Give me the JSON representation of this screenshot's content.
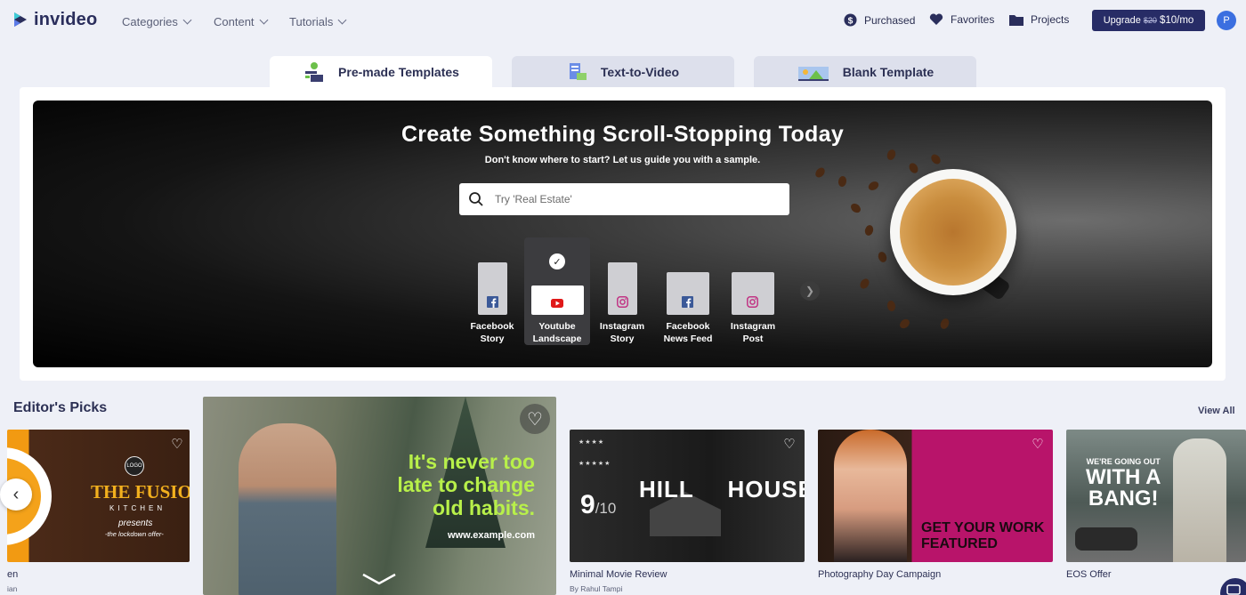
{
  "brand": {
    "name": "invideo"
  },
  "nav": {
    "categories": "Categories",
    "content": "Content",
    "tutorials": "Tutorials",
    "purchased": "Purchased",
    "favorites": "Favorites",
    "projects": "Projects",
    "upgrade_prefix": "Upgrade",
    "upgrade_old_price": "$20",
    "upgrade_price": "$10/mo",
    "avatar_initial": "P"
  },
  "tabs": [
    {
      "label": "Pre-made Templates",
      "active": true
    },
    {
      "label": "Text-to-Video",
      "active": false
    },
    {
      "label": "Blank Template",
      "active": false
    }
  ],
  "hero": {
    "title": "Create Something Scroll-Stopping Today",
    "subtitle": "Don't know where to start? Let us guide you with a sample.",
    "search_placeholder": "Try 'Real Estate'",
    "formats": [
      {
        "line1": "Facebook",
        "line2": "Story",
        "icon": "facebook-icon",
        "selected": false
      },
      {
        "line1": "Youtube",
        "line2": "Landscape",
        "icon": "youtube-icon",
        "selected": true
      },
      {
        "line1": "Instagram",
        "line2": "Story",
        "icon": "instagram-icon",
        "selected": false
      },
      {
        "line1": "Facebook",
        "line2": "News Feed",
        "icon": "facebook-icon",
        "selected": false
      },
      {
        "line1": "Instagram",
        "line2": "Post",
        "icon": "instagram-icon",
        "selected": false
      }
    ]
  },
  "picks": {
    "title": "Editor's Picks",
    "view_all": "View All",
    "items": [
      {
        "title_fragment": "en",
        "author_fragment": "ian",
        "thumb_text": "THE FUSION",
        "thumb_sub": "KITCHEN",
        "thumb_tag": "presents",
        "thumb_tag2": "-the lockdown offer-",
        "thumb_logo": "LOGO"
      },
      {
        "thumb_text1": "It's never too",
        "thumb_text2": "late to change",
        "thumb_text3": "old habits.",
        "thumb_url": "www.example.com"
      },
      {
        "title": "Minimal Movie Review",
        "author": "By Rahul Tampi",
        "thumb_title": "HILL HOUSE",
        "thumb_score": "9",
        "thumb_score_total": "/10"
      },
      {
        "title": "Photography Day Campaign",
        "thumb_text1": "GET YOUR WORK",
        "thumb_text2": "FEATURED"
      },
      {
        "title": "EOS Offer",
        "thumb_text1": "WE'RE GOING OUT",
        "thumb_text2": "WITH A",
        "thumb_text3": "BANG!"
      }
    ]
  },
  "colors": {
    "brand_navy": "#272c66",
    "background": "#eef0f7",
    "youtube_red": "#e01818",
    "facebook_blue": "#3b5998",
    "instagram_pink": "#c13584",
    "magenta_thumb": "#b8146a"
  }
}
